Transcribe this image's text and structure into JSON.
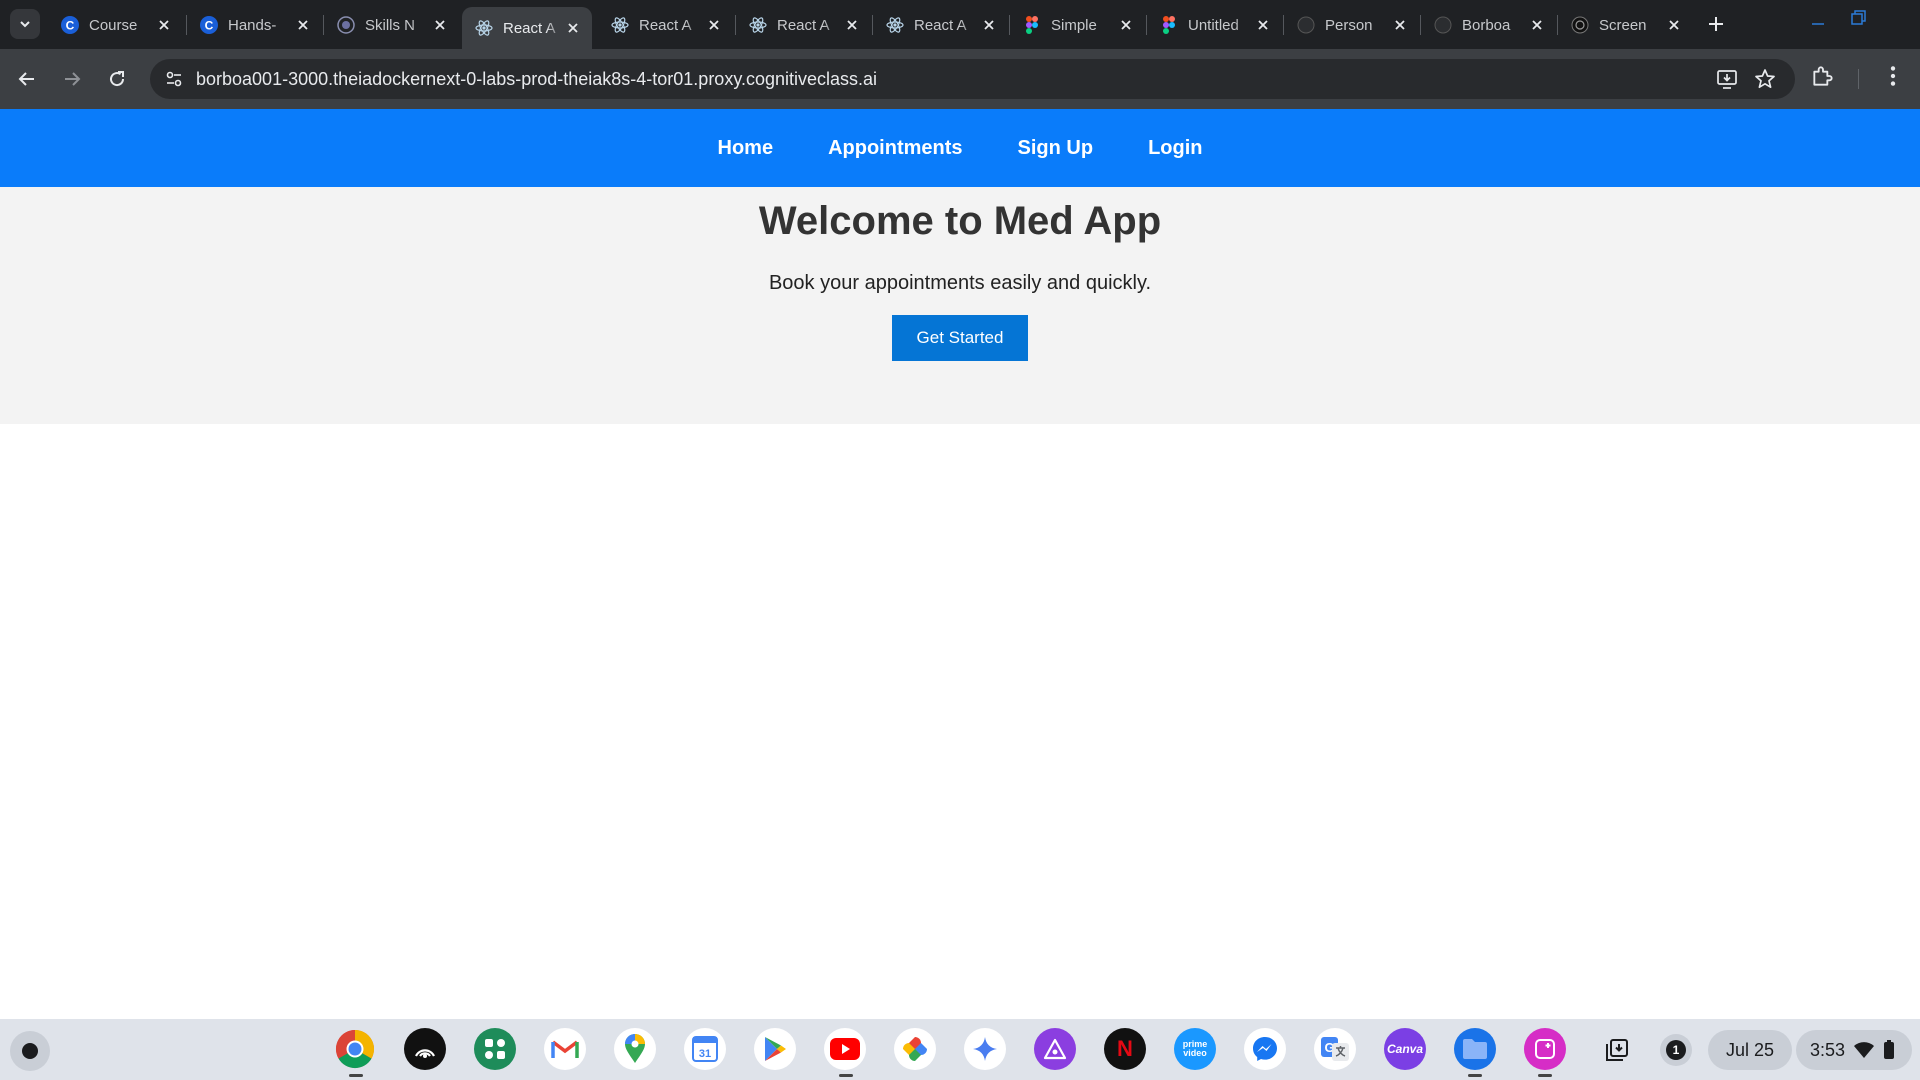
{
  "browser": {
    "tabs": [
      {
        "title": "Course",
        "favicon": "cognitiveclass-icon",
        "active": false
      },
      {
        "title": "Hands-",
        "favicon": "cognitiveclass-icon",
        "active": false
      },
      {
        "title": "Skills N",
        "favicon": "skills-network-icon",
        "active": false
      },
      {
        "title": "React A",
        "favicon": "react-icon",
        "active": true
      },
      {
        "title": "React A",
        "favicon": "react-icon",
        "active": false
      },
      {
        "title": "React A",
        "favicon": "react-icon",
        "active": false
      },
      {
        "title": "React A",
        "favicon": "react-icon",
        "active": false
      },
      {
        "title": "Simple",
        "favicon": "figma-icon",
        "active": false
      },
      {
        "title": "Untitled",
        "favicon": "figma-icon",
        "active": false
      },
      {
        "title": "Person",
        "favicon": "github-icon",
        "active": false
      },
      {
        "title": "Borboa",
        "favicon": "github-icon",
        "active": false
      },
      {
        "title": "Screen",
        "favicon": "chatgpt-icon",
        "active": false
      }
    ],
    "url": "borboa001-3000.theiadockernext-0-labs-prod-theiak8s-4-tor01.proxy.cognitiveclass.ai"
  },
  "site": {
    "nav": {
      "home": "Home",
      "appointments": "Appointments",
      "signup": "Sign Up",
      "login": "Login"
    },
    "hero": {
      "title": "Welcome to Med App",
      "subtitle": "Book your appointments easily and quickly.",
      "cta": "Get Started"
    },
    "colors": {
      "nav_bg": "#0a7cfa",
      "hero_bg": "#f3f3f3",
      "cta_bg": "#0575d5"
    }
  },
  "shelf": {
    "apps": [
      "chrome-icon",
      "podcast-icon",
      "apps-icon",
      "gmail-icon",
      "maps-icon",
      "calendar-icon",
      "play-store-icon",
      "youtube-icon",
      "photos-icon",
      "gemini-icon",
      "affinity-icon",
      "netflix-icon",
      "prime-video-icon",
      "messenger-icon",
      "google-translate-icon",
      "canva-icon",
      "files-icon",
      "screencast-icon"
    ],
    "calendar_day": "31",
    "prime_label": "prime video",
    "canva_label": "Canva",
    "netflix_label": "N",
    "notification_count": "1",
    "date": "Jul 25",
    "time": "3:53"
  }
}
